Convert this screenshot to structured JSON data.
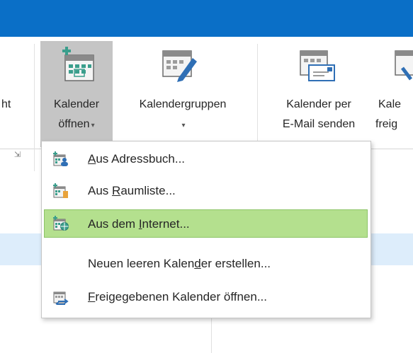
{
  "ribbon": {
    "left_cut_label": "ht",
    "open_calendar": {
      "line1": "Kalender",
      "line2": "öffnen",
      "arrow": "▾"
    },
    "calendar_groups": {
      "line1": "Kalendergruppen",
      "arrow": "▾"
    },
    "email_calendar": {
      "line1": "Kalender per",
      "line2": "E-Mail senden"
    },
    "share_calendar": {
      "line1": "Kale",
      "line2": "freig"
    },
    "launcher_glyph": "⇲"
  },
  "menu": {
    "items": [
      {
        "prefix": "",
        "accel": "A",
        "suffix": "us Adressbuch...",
        "icon": "address-book-calendar-icon",
        "highlighted": false
      },
      {
        "prefix": "Aus ",
        "accel": "R",
        "suffix": "aumliste...",
        "icon": "room-list-calendar-icon",
        "highlighted": false
      },
      {
        "prefix": "Aus dem ",
        "accel": "I",
        "suffix": "nternet...",
        "icon": "internet-calendar-icon",
        "highlighted": true
      },
      {
        "prefix": "Neuen leeren Kalen",
        "accel": "d",
        "suffix": "er erstellen...",
        "icon": "",
        "highlighted": false
      },
      {
        "prefix": "",
        "accel": "F",
        "suffix": "reigegebenen Kalender öffnen...",
        "icon": "shared-calendar-icon",
        "highlighted": false
      }
    ]
  },
  "colors": {
    "titlebar": "#0a6fc7",
    "highlight": "#b4e08e",
    "selected_row": "#ddedfb",
    "calendar_teal": "#3a9e8c"
  }
}
